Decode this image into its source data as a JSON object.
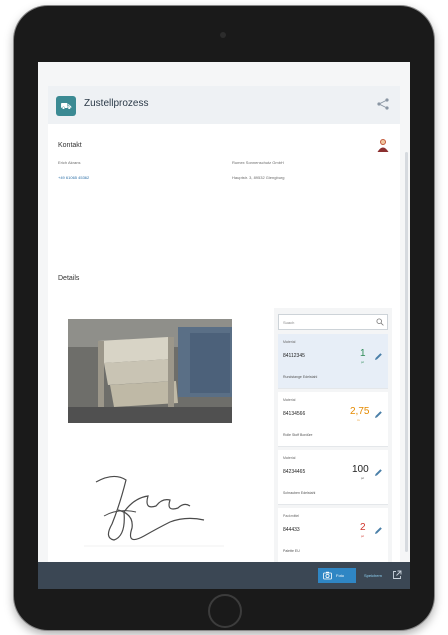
{
  "app": {
    "title": "Zustellprozess",
    "icon_text": "⛟"
  },
  "contact": {
    "heading": "Kontakt",
    "name": "Erich Akrans",
    "phone": "+49 61065 45362",
    "company": "Rumex Sonnenschutz GmbH",
    "address": "Hauptstr. 3, 89532 Giengburg"
  },
  "details": {
    "heading": "Details"
  },
  "search": {
    "placeholder": "Suach"
  },
  "materials": [
    {
      "label": "Material",
      "number": "84112345",
      "quantity": "1",
      "unit": "pc",
      "description": "Rundstange Edelstahl",
      "qty_color": "#2e8b57",
      "selected": true
    },
    {
      "label": "Material",
      "number": "84134566",
      "quantity": "2,75",
      "unit": "m",
      "description": "Rolle Stoff Bordüre",
      "qty_color": "#e58a00",
      "selected": false
    },
    {
      "label": "Material",
      "number": "84234465",
      "quantity": "100",
      "unit": "pc",
      "description": "Schrauben Edelstahl",
      "qty_color": "#222222",
      "selected": false
    },
    {
      "label": "Packmittel",
      "number": "844433",
      "quantity": "2",
      "unit": "pc",
      "description": "Palette EU",
      "qty_color": "#d0342c",
      "selected": false
    }
  ],
  "footer": {
    "foto_label": "Foto",
    "save_label": "Speichern"
  },
  "colors": {
    "accent": "#2f86c4",
    "app_icon": "#3b8a93",
    "footer": "#3b4754"
  }
}
